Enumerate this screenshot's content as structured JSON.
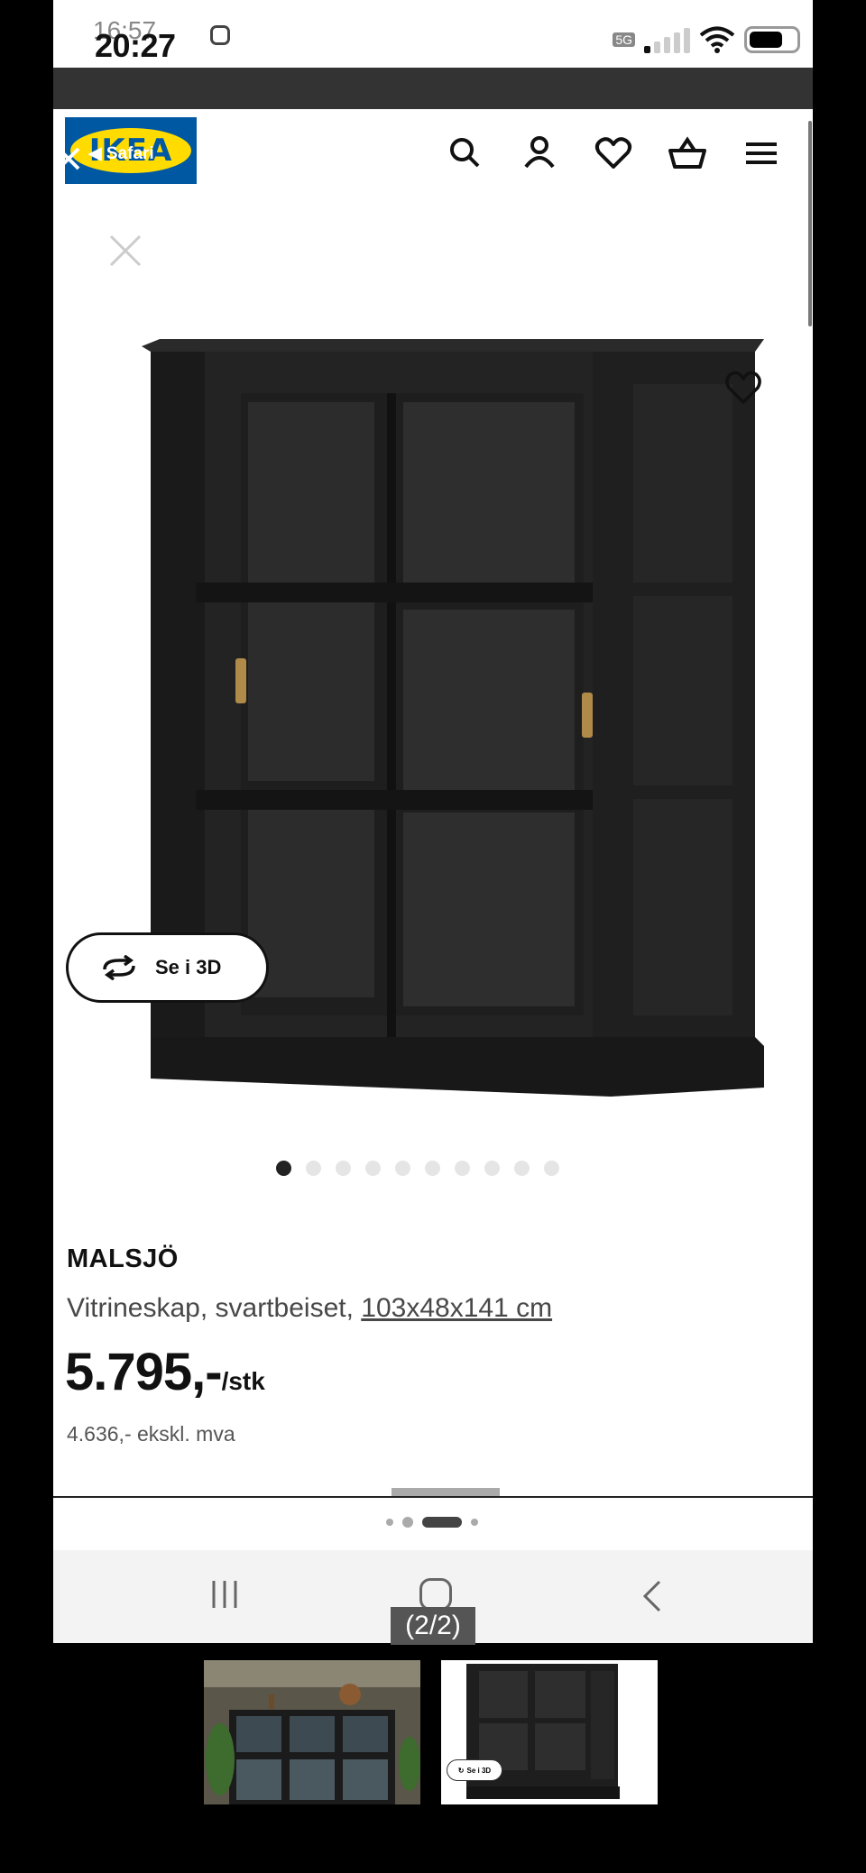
{
  "status_bar": {
    "time": "20:27",
    "time_overlay": "16:57",
    "battery": "74",
    "network": "5G"
  },
  "header": {
    "logo_text": "IKEA",
    "back_label": "◀ Safari"
  },
  "product": {
    "name": "MALSJÖ",
    "description": "Vitrineskap, svartbeiset, ",
    "dimensions": "103x48x141 cm",
    "price": "5.795,-",
    "price_unit": "/stk",
    "price_ex_vat": "4.636,- ekskl. mva",
    "view_3d_label": "Se i 3D"
  },
  "carousel": {
    "image_count": 10,
    "active_index": 0
  },
  "viewer": {
    "counter": "(2/2)"
  },
  "thumbnails": [
    {
      "name": "room-photo"
    },
    {
      "name": "product-photo",
      "button_label": "Se i 3D"
    }
  ],
  "icons": [
    "close-icon",
    "search-icon",
    "user-icon",
    "heart-icon",
    "basket-icon",
    "menu-icon",
    "rotate-3d-icon",
    "recents-icon",
    "home-icon",
    "back-icon"
  ],
  "colors": {
    "ikea_blue": "#0058a3",
    "ikea_yellow": "#ffdb00",
    "cabinet_black": "#1c1c1c"
  }
}
